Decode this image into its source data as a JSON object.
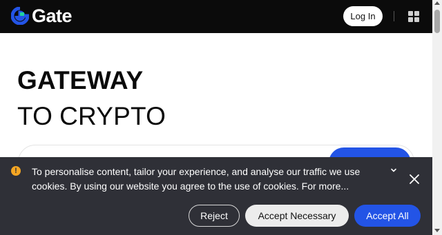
{
  "header": {
    "logo_text": "Gate",
    "login_label": "Log In",
    "apps_icon": "grid-icon"
  },
  "hero": {
    "line1": "GATEWAY",
    "line2_prefix": "TO",
    "line2_highlight": "CRYPTO",
    "highlight_color": "#a6f06a"
  },
  "cookie_banner": {
    "icon": "warning-icon",
    "text": "To personalise content, tailor your experience, and analyse our traffic we use cookies. By using our website you agree to the use of cookies. For more...",
    "expand_icon": "chevron-down-icon",
    "close_icon": "close-icon",
    "reject_label": "Reject",
    "accept_necessary_label": "Accept Necessary",
    "accept_all_label": "Accept All"
  },
  "colors": {
    "brand_blue": "#2354e6",
    "header_bg": "#0b0b0b",
    "banner_bg": "#2f3037",
    "warning": "#f5a623"
  }
}
